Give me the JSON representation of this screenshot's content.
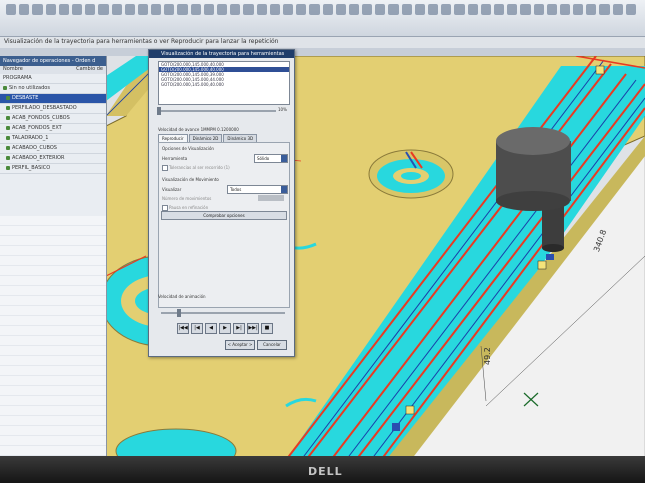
{
  "window": {
    "hint_text": "Visualización de la trayectoria para herramientas o ver Reproducir para lanzar la repetición",
    "nav_title": "Navegador de operaciones - Orden d",
    "nav_col_name": "Nombre",
    "nav_col_change": "Cambio de"
  },
  "nav": {
    "items": [
      {
        "label": "PROGRAMA",
        "level": 0,
        "selected": false
      },
      {
        "label": "Sin no utilizados",
        "level": 0,
        "selected": false
      },
      {
        "label": "DESBASTE",
        "level": 1,
        "selected": true
      },
      {
        "label": "PERFILADO_DESBASTADO",
        "level": 1,
        "selected": false
      },
      {
        "label": "ACAB_FONDOS_CUBOS",
        "level": 1,
        "selected": false
      },
      {
        "label": "ACAB_FONDOS_EXT",
        "level": 1,
        "selected": false
      },
      {
        "label": "TALADRADO_1",
        "level": 1,
        "selected": false
      },
      {
        "label": "ACABADO_CUBOS",
        "level": 1,
        "selected": false
      },
      {
        "label": "ACABADO_EXTERIOR",
        "level": 1,
        "selected": false
      },
      {
        "label": "PERFIL_BASICO",
        "level": 1,
        "selected": false
      }
    ]
  },
  "dialog": {
    "title": "Visualización de la trayectoria para herramientas",
    "list_rows": [
      "GOTO/200.000,145.000,40.000",
      "GOTO/200.000,145.000,40.000",
      "GOTO/200.000,145.000,39.000",
      "GOTO/200.000,145.000,44.000",
      "GOTO/200.000,145.000,40.000"
    ],
    "list_selected_index": 1,
    "progress_percent": "10%",
    "speed_label": "Velocidad de avance 1MMPM 0.1200000",
    "tabs": [
      "Reproducir",
      "Dinámico 2D",
      "Dinámico 3D"
    ],
    "active_tab": 0,
    "group_label": "Opciones de Visualización",
    "tool_label": "Herramienta",
    "tool_value": "Sólido",
    "check_label_1": "Tolerancias al ser recorrido (1)",
    "movement_group": "Visualización de Movimiento",
    "visualize_label": "Visualizar",
    "visualize_value": "Todos",
    "steps_label": "Número de movimientos",
    "check_label_2": "Pausa en refinación",
    "check_button": "Comprobar opciones",
    "anim_speed_label": "Velocidad de animación",
    "player_buttons": [
      "|◀◀",
      "|◀",
      "◀",
      "▶",
      "▶|",
      "▶▶|",
      "■"
    ],
    "ok_button": "< Aceptar >",
    "cancel_button": "Cancelar"
  },
  "dimensions": [
    "340.8",
    "49.2"
  ],
  "bezel_logo": "DELL",
  "colors": {
    "stock_yellow": "#e3cf72",
    "toolpath_cyan": "#28d8de",
    "toolpath_red": "#e83a22",
    "selection_blue": "#2a55a8"
  }
}
